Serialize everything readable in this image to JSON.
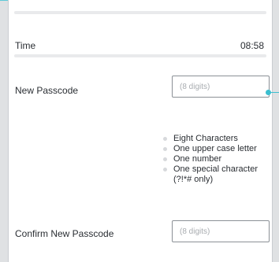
{
  "time": {
    "label": "Time",
    "value": "08:58"
  },
  "new_passcode": {
    "label": "New Passcode",
    "placeholder": "(8 digits)",
    "requirements": [
      "Eight Characters",
      "One upper case letter",
      "One number",
      "One special character (?!*# only)"
    ]
  },
  "confirm_passcode": {
    "label": "Confirm New Passcode",
    "placeholder": "(8 digits)"
  },
  "colors": {
    "accent": "#3cbfd0",
    "bullet": "#d7d9dc",
    "divider": "#e9eaec"
  }
}
